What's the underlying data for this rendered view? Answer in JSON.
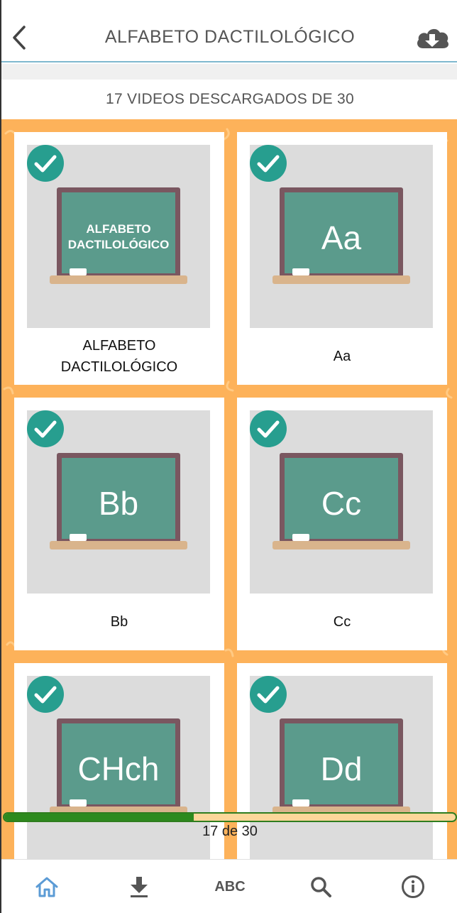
{
  "header": {
    "title": "ALFABETO DACTILOLÓGICO",
    "back_icon": "chevron-left-icon",
    "download_icon": "cloud-download-icon"
  },
  "status": {
    "downloaded_text": "17 VIDEOS DESCARGADOS DE 30"
  },
  "grid": {
    "items": [
      {
        "label": "ALFABETO\nDACTILOLÓGICO",
        "board_text": "ALFABETO\nDACTILOLÓGICO",
        "downloaded": true
      },
      {
        "label": "Aa",
        "board_text": "Aa",
        "downloaded": true
      },
      {
        "label": "Bb",
        "board_text": "Bb",
        "downloaded": true
      },
      {
        "label": "Cc",
        "board_text": "Cc",
        "downloaded": true
      },
      {
        "label": "CHch",
        "board_text": "CHch",
        "downloaded": true
      },
      {
        "label": "Dd",
        "board_text": "Dd",
        "downloaded": true
      }
    ]
  },
  "progress": {
    "text": "17 de 30",
    "fraction": 0.42
  },
  "bottom_nav": {
    "abc_label": "ABC",
    "icons": [
      "home-icon",
      "download-icon",
      "abc",
      "search-icon",
      "info-icon"
    ]
  },
  "colors": {
    "accent_teal": "#279e8f",
    "board_green": "#5b9b8c",
    "background_orange": "#fdb25a",
    "progress_green": "#2d8a1e",
    "home_active": "#5b9bd5"
  }
}
